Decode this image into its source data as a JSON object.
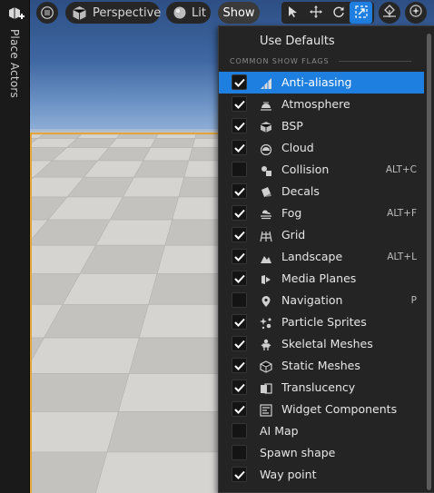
{
  "left_panel": {
    "label": "Place Actors"
  },
  "toolbar": {
    "perspective_label": "Perspective",
    "lit_label": "Lit",
    "show_label": "Show",
    "accent_color": "#1f7fe0"
  },
  "menu": {
    "use_defaults": "Use Defaults",
    "section_title": "COMMON SHOW FLAGS",
    "items": [
      {
        "label": "Anti-aliasing",
        "checked": true,
        "icon": "anti-aliasing-icon",
        "shortcut": "",
        "highlighted": true
      },
      {
        "label": "Atmosphere",
        "checked": true,
        "icon": "atmosphere-icon",
        "shortcut": ""
      },
      {
        "label": "BSP",
        "checked": true,
        "icon": "bsp-icon",
        "shortcut": ""
      },
      {
        "label": "Cloud",
        "checked": true,
        "icon": "cloud-icon",
        "shortcut": ""
      },
      {
        "label": "Collision",
        "checked": false,
        "icon": "collision-icon",
        "shortcut": "ALT+C"
      },
      {
        "label": "Decals",
        "checked": true,
        "icon": "decals-icon",
        "shortcut": ""
      },
      {
        "label": "Fog",
        "checked": true,
        "icon": "fog-icon",
        "shortcut": "ALT+F"
      },
      {
        "label": "Grid",
        "checked": true,
        "icon": "grid-icon",
        "shortcut": ""
      },
      {
        "label": "Landscape",
        "checked": true,
        "icon": "landscape-icon",
        "shortcut": "ALT+L"
      },
      {
        "label": "Media Planes",
        "checked": true,
        "icon": "media-planes-icon",
        "shortcut": ""
      },
      {
        "label": "Navigation",
        "checked": false,
        "icon": "navigation-icon",
        "shortcut": "P"
      },
      {
        "label": "Particle Sprites",
        "checked": true,
        "icon": "particle-sprites-icon",
        "shortcut": ""
      },
      {
        "label": "Skeletal Meshes",
        "checked": true,
        "icon": "skeletal-meshes-icon",
        "shortcut": ""
      },
      {
        "label": "Static Meshes",
        "checked": true,
        "icon": "static-meshes-icon",
        "shortcut": ""
      },
      {
        "label": "Translucency",
        "checked": true,
        "icon": "translucency-icon",
        "shortcut": ""
      },
      {
        "label": "Widget Components",
        "checked": true,
        "icon": "widget-components-icon",
        "shortcut": ""
      },
      {
        "label": "AI Map",
        "checked": false,
        "icon": "",
        "shortcut": ""
      },
      {
        "label": "Spawn shape",
        "checked": false,
        "icon": "",
        "shortcut": ""
      },
      {
        "label": "Way point",
        "checked": true,
        "icon": "",
        "shortcut": ""
      }
    ]
  }
}
